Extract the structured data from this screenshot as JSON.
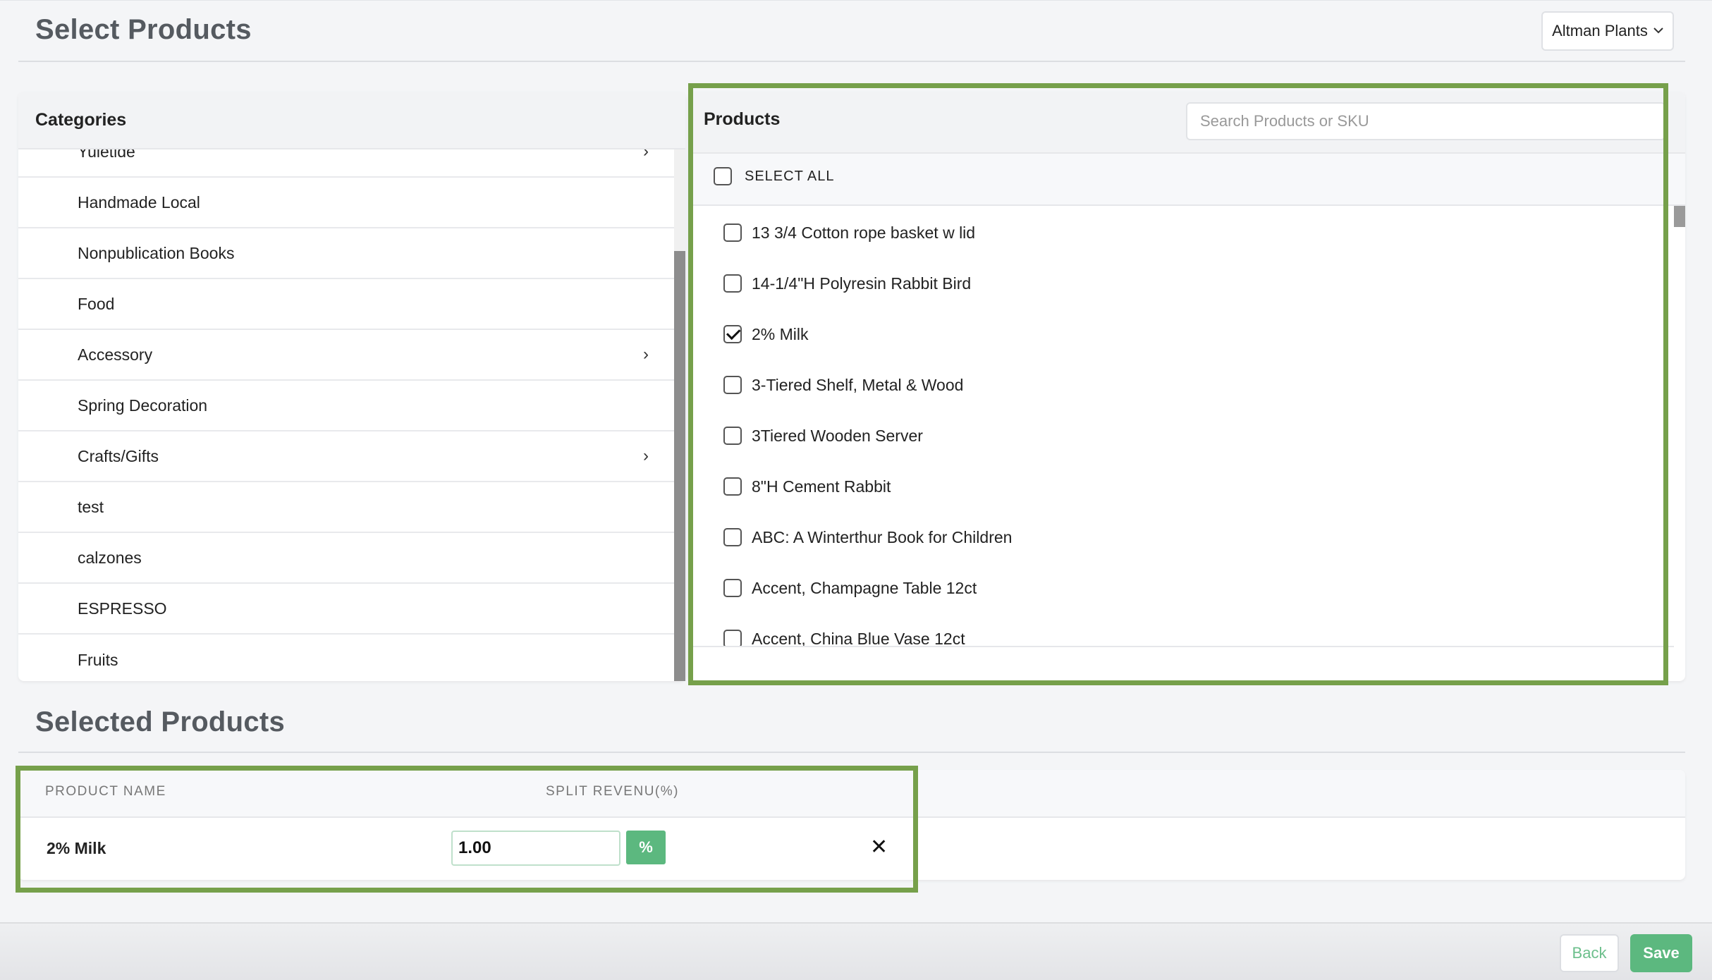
{
  "header": {
    "title": "Select Products",
    "store_selector": {
      "label": "Altman Plants",
      "icon": "chevron-down-icon"
    }
  },
  "categories": {
    "title": "Categories",
    "items": [
      {
        "label": "Yuletide",
        "has_children": true
      },
      {
        "label": "Handmade Local",
        "has_children": false
      },
      {
        "label": "Nonpublication Books",
        "has_children": false
      },
      {
        "label": "Food",
        "has_children": false
      },
      {
        "label": "Accessory",
        "has_children": true
      },
      {
        "label": "Spring Decoration",
        "has_children": false
      },
      {
        "label": "Crafts/Gifts",
        "has_children": true
      },
      {
        "label": "test",
        "has_children": false
      },
      {
        "label": "calzones",
        "has_children": false
      },
      {
        "label": "ESPRESSO",
        "has_children": false
      },
      {
        "label": "Fruits",
        "has_children": false
      }
    ],
    "arrow_glyph": "›"
  },
  "products": {
    "title": "Products",
    "search_placeholder": "Search Products or SKU",
    "select_all_label": "SELECT ALL",
    "items": [
      {
        "label": "13 3/4 Cotton rope basket w lid",
        "checked": false
      },
      {
        "label": "14-1/4\"H Polyresin Rabbit Bird",
        "checked": false
      },
      {
        "label": "2% Milk",
        "checked": true
      },
      {
        "label": "3-Tiered Shelf, Metal & Wood",
        "checked": false
      },
      {
        "label": "3Tiered Wooden Server",
        "checked": false
      },
      {
        "label": "8\"H Cement Rabbit",
        "checked": false
      },
      {
        "label": "ABC: A Winterthur Book for Children",
        "checked": false
      },
      {
        "label": "Accent, Champagne Table 12ct",
        "checked": false
      },
      {
        "label": "Accent, China Blue Vase 12ct",
        "checked": false
      }
    ]
  },
  "selected": {
    "title": "Selected Products",
    "columns": {
      "name": "PRODUCT NAME",
      "split": "SPLIT REVENU(%)"
    },
    "rows": [
      {
        "name": "2% Milk",
        "split": "1.00",
        "unit": "%",
        "remove_glyph": "✕"
      }
    ]
  },
  "footer": {
    "back_label": "Back",
    "save_label": "Save"
  },
  "colors": {
    "accent_green": "#5cb87f",
    "highlight_border": "#76a04b"
  }
}
